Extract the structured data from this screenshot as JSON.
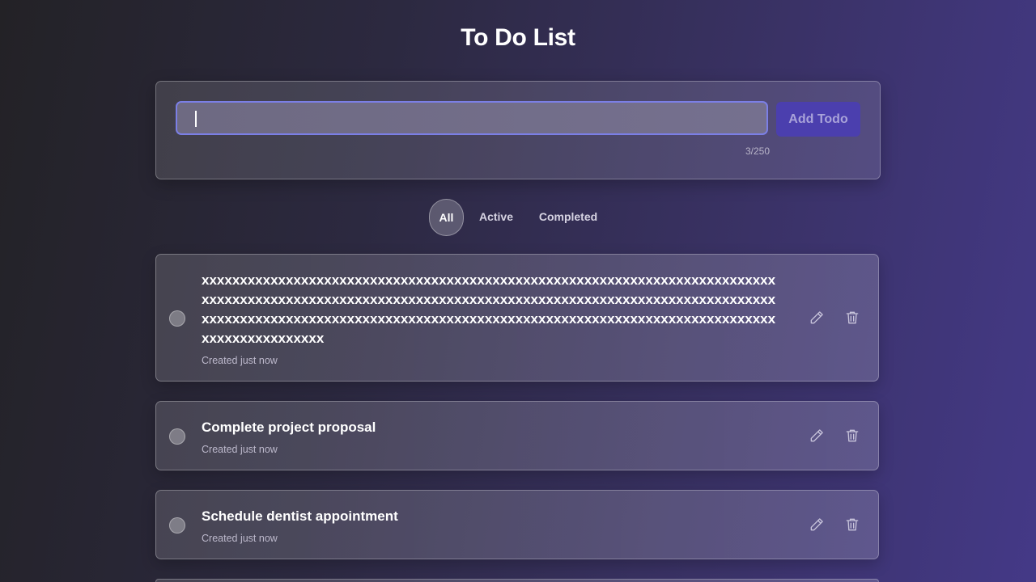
{
  "header": {
    "title": "To Do List"
  },
  "composer": {
    "input_value": "",
    "char_count": "3/250",
    "add_label": "Add Todo",
    "colors": {
      "focus_border": "#7b7fe6",
      "button": "#4b3fae"
    }
  },
  "filters": {
    "all": "All",
    "active": "Active",
    "completed": "Completed",
    "selected": "All"
  },
  "todos": [
    {
      "text": "xxxxxxxxxxxxxxxxxxxxxxxxxxxxxxxxxxxxxxxxxxxxxxxxxxxxxxxxxxxxxxxxxxxxxxxxxxxxxxxxxxxxxxxxxxxxxxxxxxxxxxxxxxxxxxxxxxxxxxxxxxxxxxxxxxxxxxxxxxxxxxxxxxxxxxxxxxxxxxxxxxxxxxxxxxxxxxxxxxxxxxxxxxxxxxxxxxxxxxxxxxxxxxxxxxxxxxxxxxxxxxxxxxxxxxxxxxxxxxxxx",
      "meta": "Created just now",
      "completed": false
    },
    {
      "text": "Complete project proposal",
      "meta": "Created just now",
      "completed": false
    },
    {
      "text": "Schedule dentist appointment",
      "meta": "Created just now",
      "completed": false
    }
  ],
  "icons": {
    "edit": "pencil-icon",
    "delete": "trash-icon",
    "checkbox": "circle-checkbox"
  }
}
